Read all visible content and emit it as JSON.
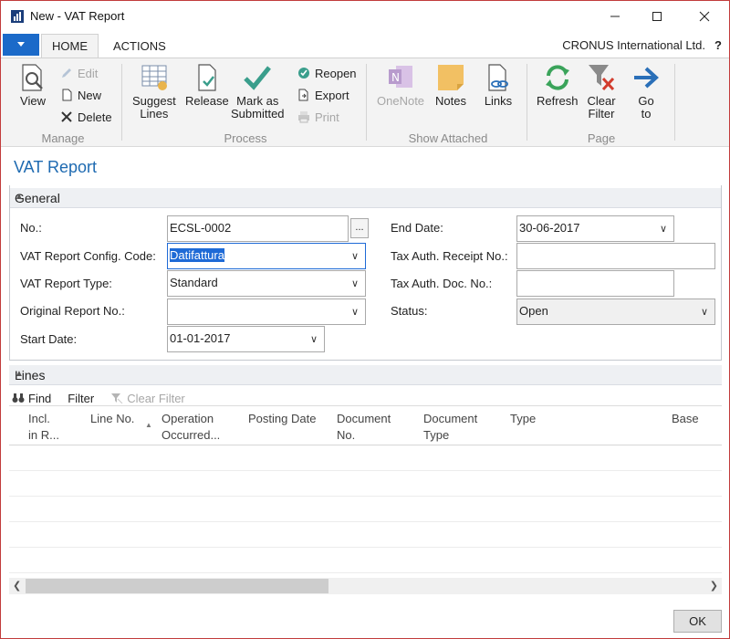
{
  "window": {
    "title": "New - VAT Report"
  },
  "ribbon_tabs": [
    {
      "label": "HOME"
    },
    {
      "label": "ACTIONS"
    }
  ],
  "company": "CRONUS International Ltd.",
  "help": "?",
  "ribbon": {
    "manage": {
      "label": "Manage",
      "view": "View",
      "edit": "Edit",
      "new": "New",
      "delete": "Delete"
    },
    "process": {
      "label": "Process",
      "suggest_lines_1": "Suggest",
      "suggest_lines_2": "Lines",
      "release": "Release",
      "mark_submitted_1": "Mark as",
      "mark_submitted_2": "Submitted",
      "reopen": "Reopen",
      "export": "Export",
      "print": "Print"
    },
    "show_attached": {
      "label": "Show Attached",
      "onenote": "OneNote",
      "notes": "Notes",
      "links": "Links"
    },
    "page": {
      "label": "Page",
      "refresh": "Refresh",
      "clear_filter_1": "Clear",
      "clear_filter_2": "Filter",
      "goto_1": "Go",
      "goto_2": "to"
    }
  },
  "page_title": "VAT Report",
  "general": {
    "section_label": "General",
    "no_label": "No.:",
    "no_value": "ECSL-0002",
    "dots": "...",
    "config_label": "VAT Report Config. Code:",
    "config_value": "Datifattura",
    "type_label": "VAT Report Type:",
    "type_value": "Standard",
    "orig_label": "Original Report No.:",
    "orig_value": "",
    "start_label": "Start Date:",
    "start_value": "01-01-2017",
    "end_label": "End Date:",
    "end_value": "30-06-2017",
    "receipt_label": "Tax Auth. Receipt No.:",
    "receipt_value": "",
    "doc_label": "Tax Auth. Doc. No.:",
    "doc_value": "",
    "status_label": "Status:",
    "status_value": "Open"
  },
  "lines": {
    "section_label": "Lines",
    "find": "Find",
    "filter": "Filter",
    "clear_filter": "Clear Filter",
    "columns": [
      {
        "l1": "Incl.",
        "l2": "in R..."
      },
      {
        "l1": "Line No.",
        "l2": ""
      },
      {
        "l1": "Operation",
        "l2": "Occurred..."
      },
      {
        "l1": "Posting Date",
        "l2": ""
      },
      {
        "l1": "Document",
        "l2": "No."
      },
      {
        "l1": "Document",
        "l2": "Type"
      },
      {
        "l1": "Type",
        "l2": ""
      },
      {
        "l1": "Base",
        "l2": ""
      }
    ]
  },
  "ok": "OK",
  "colors": {
    "accent": "#1e6ab1",
    "menu_blue": "#1b6ac9",
    "refresh_green": "#3aa35a",
    "check_teal": "#3a9e8c"
  }
}
